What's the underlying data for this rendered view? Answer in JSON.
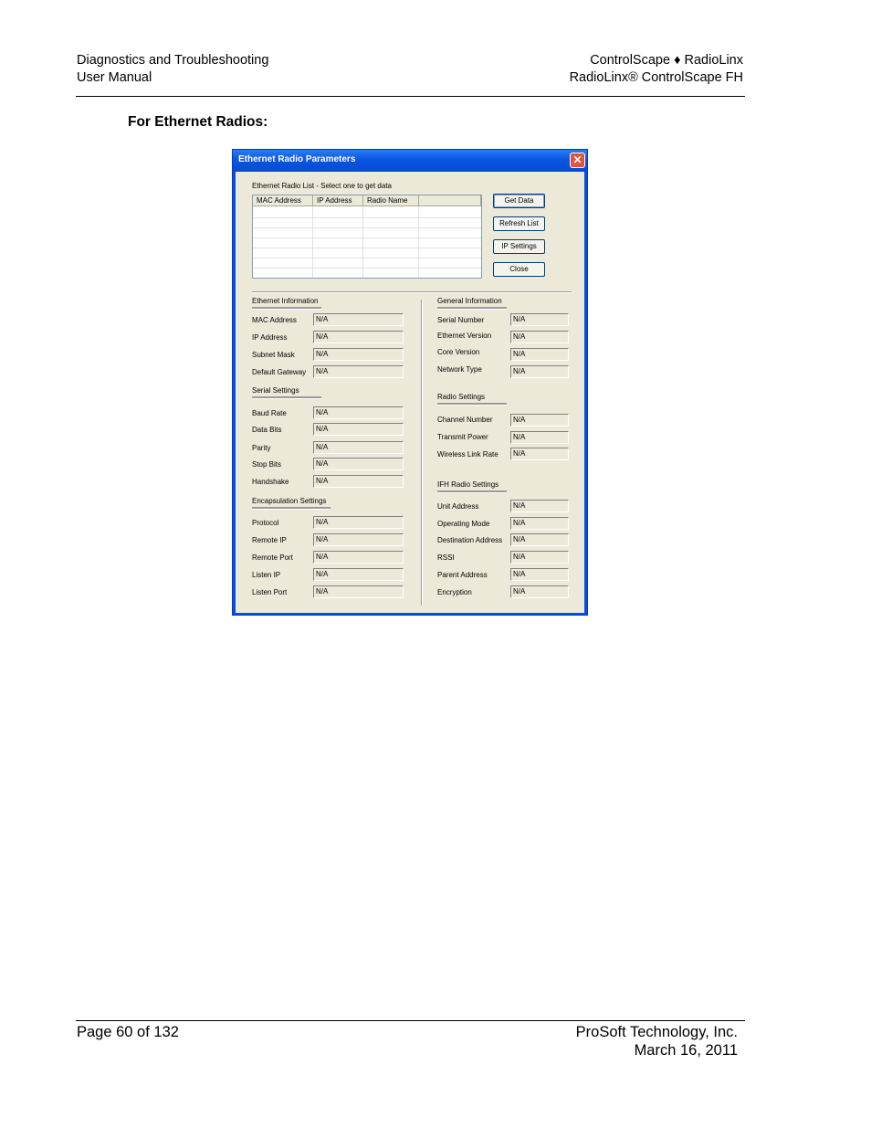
{
  "header": {
    "left_line1": "Diagnostics and Troubleshooting",
    "left_line2": "User Manual",
    "right_line1": "ControlScape ♦ RadioLinx",
    "right_line2": "RadioLinx®  ControlScape FH"
  },
  "section_heading": "For Ethernet Radios:",
  "dialog": {
    "title": "Ethernet Radio Parameters",
    "close_glyph": "✕",
    "list_label": "Ethernet Radio List - Select one to get data",
    "list_columns": [
      "MAC Address",
      "IP Address",
      "Radio Name",
      ""
    ],
    "buttons": {
      "get_data": "Get Data",
      "refresh_list": "Refresh List",
      "ip_settings": "IP Settings",
      "close": "Close"
    },
    "ethernet_info": {
      "heading": "Ethernet Information",
      "fields": [
        {
          "label": "MAC Address",
          "value": "N/A"
        },
        {
          "label": "IP Address",
          "value": "N/A"
        },
        {
          "label": "Subnet Mask",
          "value": "N/A"
        },
        {
          "label": "Default Gateway",
          "value": "N/A"
        }
      ]
    },
    "serial_settings": {
      "heading": "Serial Settings",
      "fields": [
        {
          "label": "Baud Rate",
          "value": "N/A"
        },
        {
          "label": "Data Bits",
          "value": "N/A"
        },
        {
          "label": "Parity",
          "value": "N/A"
        },
        {
          "label": "Stop Bits",
          "value": "N/A"
        },
        {
          "label": "Handshake",
          "value": "N/A"
        }
      ]
    },
    "encapsulation_settings": {
      "heading": "Encapsulation Settings",
      "fields": [
        {
          "label": "Protocol",
          "value": "N/A"
        },
        {
          "label": "Remote IP",
          "value": "N/A"
        },
        {
          "label": "Remote Port",
          "value": "N/A"
        },
        {
          "label": "Listen IP",
          "value": "N/A"
        },
        {
          "label": "Listen Port",
          "value": "N/A"
        }
      ]
    },
    "general_info": {
      "heading": "General Information",
      "fields": [
        {
          "label": "Serial Number",
          "value": "N/A"
        },
        {
          "label": "Ethernet Version",
          "value": "N/A"
        },
        {
          "label": "Core Version",
          "value": "N/A"
        },
        {
          "label": "Network Type",
          "value": "N/A"
        }
      ]
    },
    "radio_settings": {
      "heading": "Radio Settings",
      "fields": [
        {
          "label": "Channel Number",
          "value": "N/A"
        },
        {
          "label": "Transmit Power",
          "value": "N/A"
        },
        {
          "label": "Wireless Link Rate",
          "value": "N/A"
        }
      ]
    },
    "ifh_radio_settings": {
      "heading": "IFH Radio Settings",
      "fields": [
        {
          "label": "Unit Address",
          "value": "N/A"
        },
        {
          "label": "Operating Mode",
          "value": "N/A"
        },
        {
          "label": "Destination Address",
          "value": "N/A"
        },
        {
          "label": "RSSI",
          "value": "N/A"
        },
        {
          "label": "Parent Address",
          "value": "N/A"
        },
        {
          "label": "Encryption",
          "value": "N/A"
        }
      ]
    }
  },
  "footer": {
    "page": "Page 60 of 132",
    "company": "ProSoft Technology, Inc.",
    "date": "March 16, 2011"
  },
  "colors": {
    "title_bar": "#0a56e2",
    "dialog_face": "#ece9d8",
    "close_button": "#e0553a"
  }
}
